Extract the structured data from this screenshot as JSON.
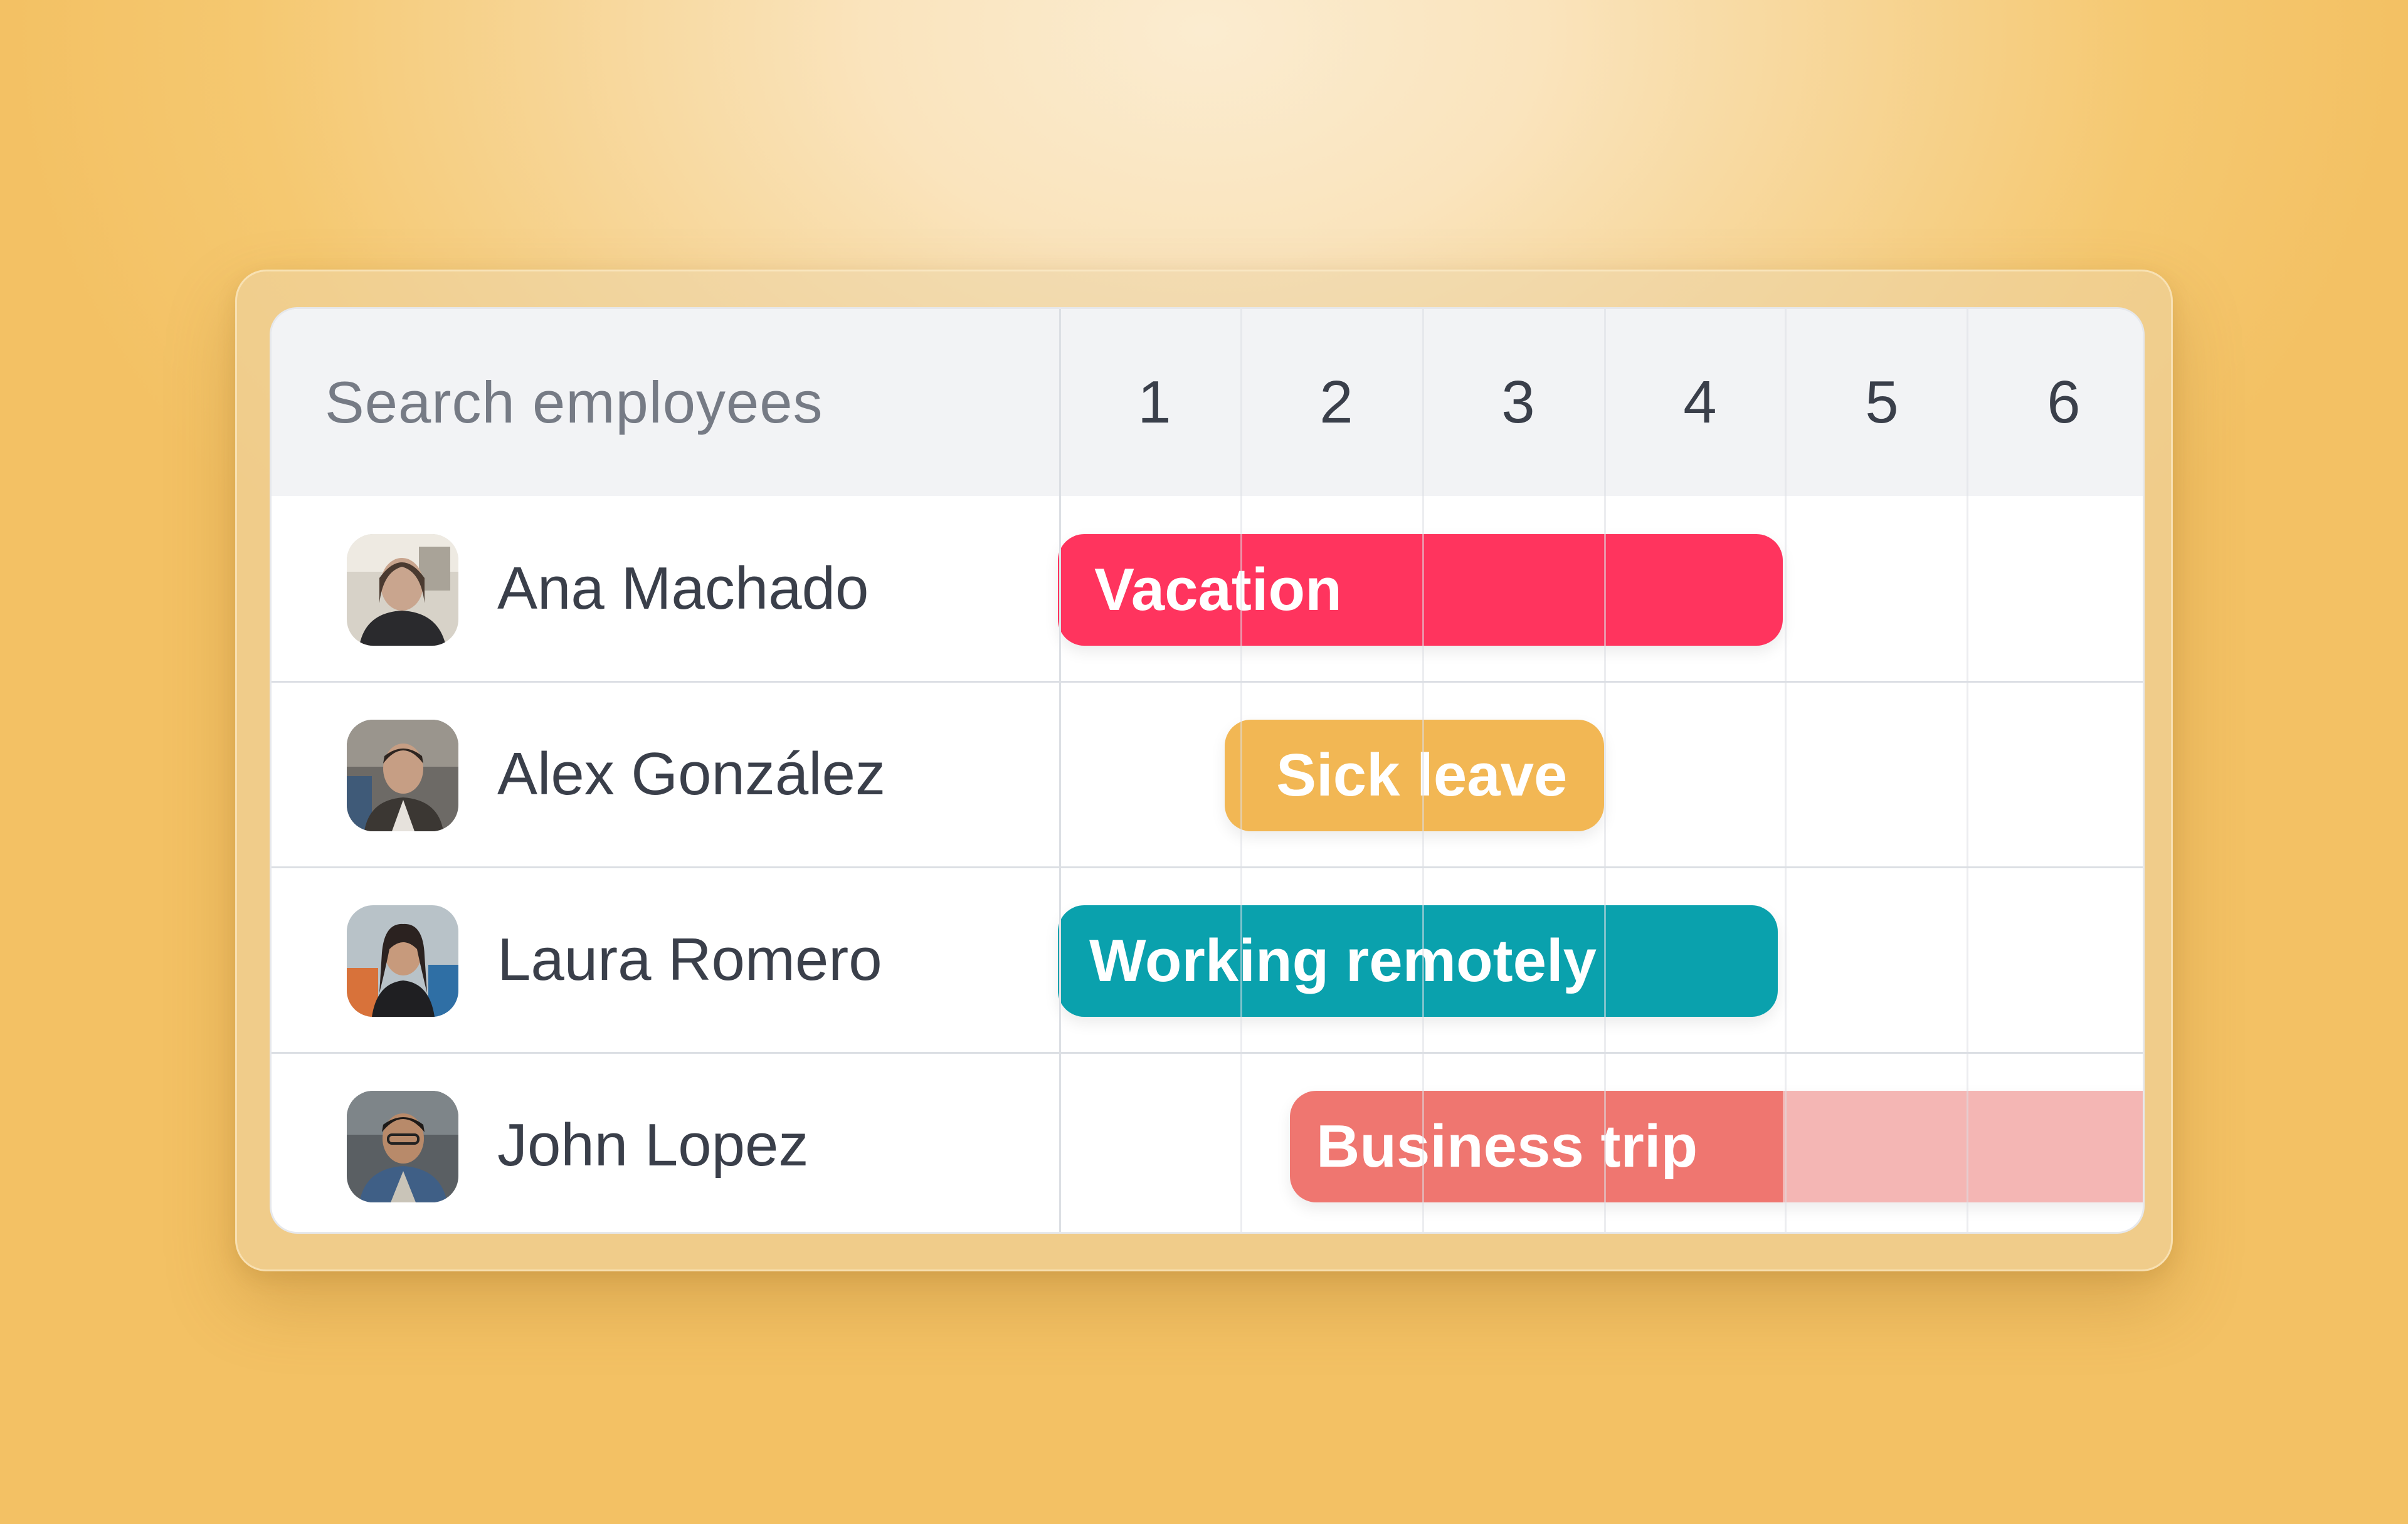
{
  "search": {
    "placeholder": "Search employees"
  },
  "days": [
    "1",
    "2",
    "3",
    "4",
    "5",
    "6"
  ],
  "employees": [
    {
      "name": "Ana Machado",
      "event": "Vacation",
      "color": "#ff345e"
    },
    {
      "name": "Alex González",
      "event": "Sick leave",
      "color": "#f2b754"
    },
    {
      "name": "Laura Romero",
      "event": "Working remotely",
      "color": "#0aa1ad"
    },
    {
      "name": "John Lopez",
      "event": "Business trip",
      "color": "#ef7670"
    }
  ],
  "colors": {
    "background": "#f5c870",
    "header": "#f2f3f5",
    "text": "#3a3f4a",
    "business_trip_fade": "#f4b6b4"
  }
}
